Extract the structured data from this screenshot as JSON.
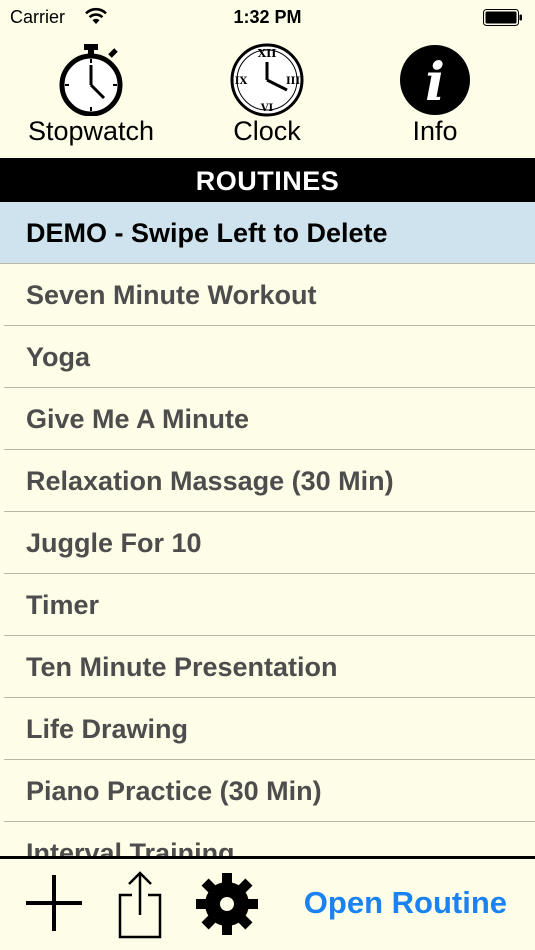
{
  "status": {
    "carrier": "Carrier",
    "time": "1:32 PM"
  },
  "toolbar": {
    "stopwatch_label": "Stopwatch",
    "clock_label": "Clock",
    "info_label": "Info"
  },
  "header": {
    "title": "ROUTINES"
  },
  "routines": [
    "DEMO - Swipe Left to Delete",
    "Seven Minute Workout",
    "Yoga",
    "Give Me A Minute",
    "Relaxation Massage (30 Min)",
    "Juggle For 10",
    "Timer",
    "Ten Minute Presentation",
    "Life Drawing",
    "Piano Practice (30 Min)",
    "Interval Training"
  ],
  "bottom": {
    "open_label": "Open Routine"
  },
  "icons": {
    "stopwatch": "stopwatch-icon",
    "clock": "clock-icon",
    "info": "info-icon",
    "add": "plus-icon",
    "share": "share-icon",
    "settings": "gear-icon"
  },
  "colors": {
    "background": "#fdfde8",
    "selected_row": "#cfe3ee",
    "header_bg": "#000000",
    "accent": "#1a82f2"
  }
}
